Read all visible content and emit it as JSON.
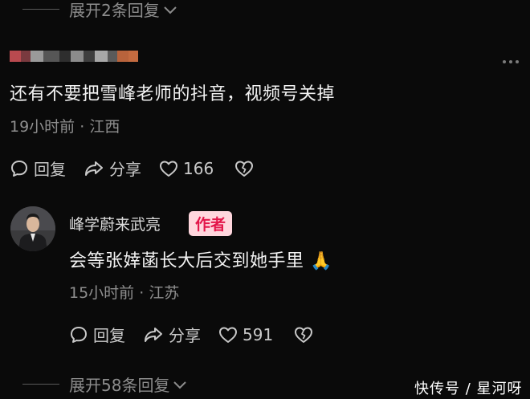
{
  "top_expand": {
    "label": "展开2条回复"
  },
  "comment": {
    "text": "还有不要把雪峰老师的抖音，视频号关掉",
    "time": "19小时前",
    "location": "江西",
    "actions": {
      "reply_label": "回复",
      "share_label": "分享",
      "like_count": "166"
    }
  },
  "reply": {
    "username": "峰学蔚来武亮",
    "badge": "作者",
    "text": "会等张婞菡长大后交到她手里",
    "emoji": "🙏",
    "time": "15小时前",
    "location": "江苏",
    "actions": {
      "reply_label": "回复",
      "share_label": "分享",
      "like_count": "591"
    }
  },
  "bottom_expand": {
    "label": "展开58条回复"
  },
  "watermark": {
    "text": "快传号 / 星河呀"
  },
  "colors": {
    "background": "#0a0a0a",
    "badge_bg": "#ffd6dd",
    "badge_text": "#e3164a",
    "muted": "#8f8f8f"
  }
}
